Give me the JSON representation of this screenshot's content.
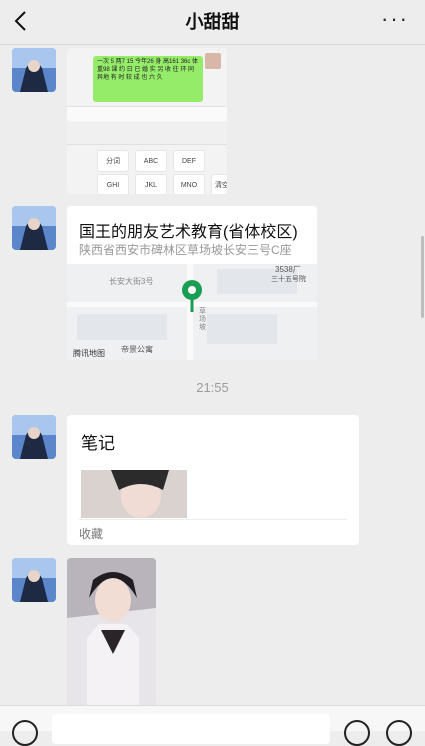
{
  "header": {
    "title": "小甜甜"
  },
  "messages": {
    "screenshot_msg": {
      "green_text": "一次 5 两7 15 今年26 身 高161 36c 体重98 课 约 日 已 婚 实 另 收 往 环 同 异地 有 时 较 成 也 六 久"
    },
    "keyboard": {
      "row1": [
        "分词",
        "ABC",
        "DEF"
      ],
      "row2": [
        "GHI",
        "JKL",
        "MNO",
        "清空"
      ]
    },
    "location_msg": {
      "name": "国王的朋友艺术教育(省体校区)",
      "address": "陕西省西安市碑林区草场坡长安三号C座",
      "map_labels": {
        "building": "3538厂",
        "building2": "三十五号院",
        "road": "长安大街3号",
        "side": "草场坡",
        "apartment": "帝景公寓",
        "attribution": "腾讯地图"
      }
    },
    "timestamp": "21:55",
    "note_msg": {
      "title": "笔记",
      "footer": "收藏"
    }
  },
  "colors": {
    "accent_green": "#1a9e55",
    "chat_bg": "#ededed"
  }
}
